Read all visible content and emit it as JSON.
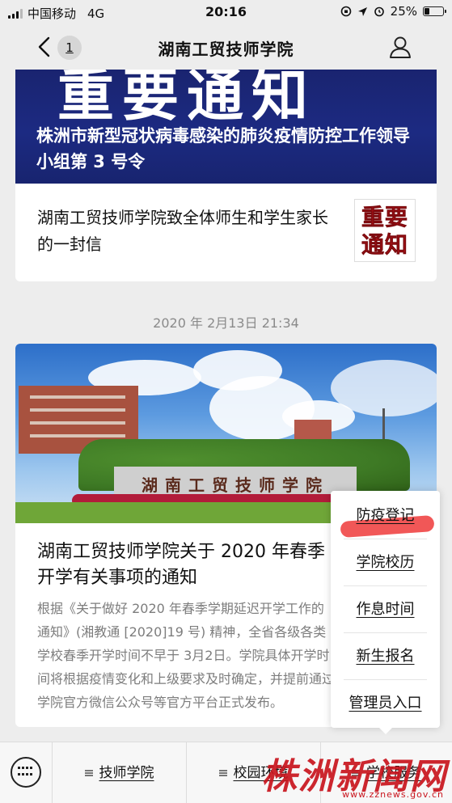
{
  "status_bar": {
    "carrier": "中国移动",
    "network": "4G",
    "time": "20:16",
    "battery_percent": "25%",
    "battery_level": 0.25
  },
  "nav": {
    "title": "湖南工贸技师学院",
    "unread_badge": "1",
    "back_icon": "chevron-left-icon",
    "profile_icon": "user-icon"
  },
  "article1": {
    "banner_headline": "重要通知",
    "banner_subtitle": "株洲市新型冠状病毒感染的肺炎疫情防控工作领导小组第 3 号令",
    "title": "湖南工贸技师学院致全体师生和学生家长的一封信",
    "stamp_line1": "重要",
    "stamp_line2": "通知"
  },
  "timestamp": "2020 年 2月13日 21:34",
  "article2": {
    "gate_text": "湖南工贸技师学院",
    "title": "湖南工贸技师学院关于 2020 年春季开学有关事项的通知",
    "summary": "根据《关于做好 2020 年春季学期延迟开学工作的通知》(湘教通 [2020]19 号) 精神，全省各级各类学校春季开学时间不早于 3月2日。学院具体开学时间将根据疫情变化和上级要求及时确定，并提前通过学院官方微信公众号等官方平台正式发布。"
  },
  "popup_menu": {
    "items": [
      "防疫登记",
      "学院校历",
      "作息时间",
      "新生报名",
      "管理员入口"
    ]
  },
  "tab_bar": {
    "keyboard_icon": "keyboard-icon",
    "tabs": [
      "技师学院",
      "校园环境",
      "学校服务"
    ]
  },
  "watermark": {
    "text": "株洲新闻网",
    "url": "www.zznews.gov.cn"
  },
  "colors": {
    "background": "#ededed",
    "banner_blue": "#1c2a82",
    "stamp_red": "#c4141b",
    "watermark_red": "#c9151e"
  }
}
